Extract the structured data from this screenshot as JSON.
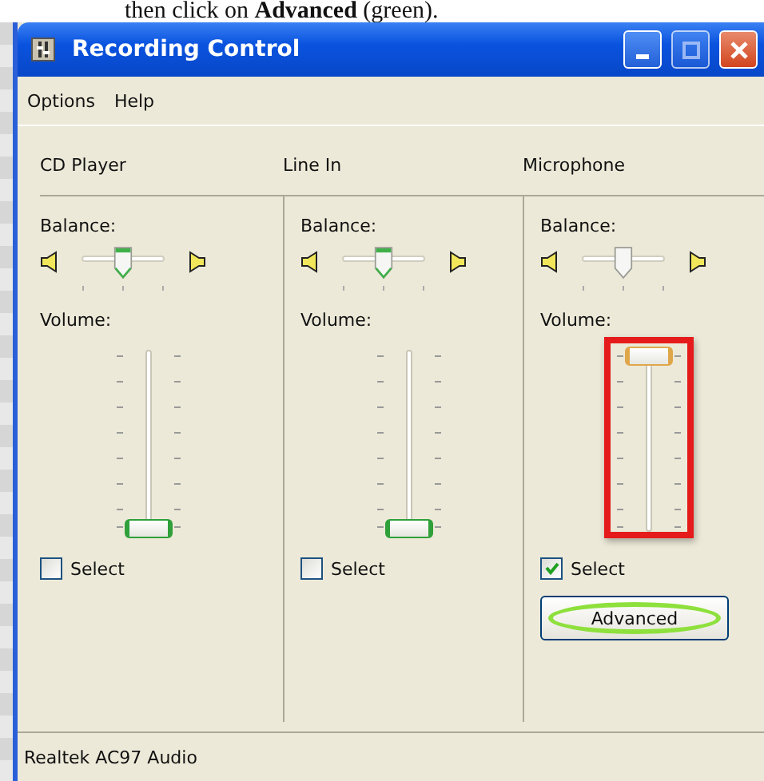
{
  "caption": "then click on **Advanced** (green).",
  "window": {
    "title": "Recording Control"
  },
  "menu": [
    {
      "label": "Options"
    },
    {
      "label": "Help"
    }
  ],
  "channels": [
    {
      "name": "CD Player",
      "balance_label": "Balance:",
      "balance": {
        "level": 0.5,
        "focused": false
      },
      "volume_label": "Volume:",
      "volume": {
        "level": 0.0,
        "focused": false,
        "highlighted": false
      },
      "select": {
        "label": "Select",
        "checked": false
      }
    },
    {
      "name": "Line In",
      "balance_label": "Balance:",
      "balance": {
        "level": 0.5,
        "focused": false
      },
      "volume_label": "Volume:",
      "volume": {
        "level": 0.0,
        "focused": false,
        "highlighted": false
      },
      "select": {
        "label": "Select",
        "checked": false
      }
    },
    {
      "name": "Microphone",
      "balance_label": "Balance:",
      "balance": {
        "level": 0.5,
        "focused": true
      },
      "volume_label": "Volume:",
      "volume": {
        "level": 1.0,
        "focused": true,
        "highlighted": true
      },
      "select": {
        "label": "Select",
        "checked": true
      },
      "advanced_button": {
        "label": "Advanced",
        "highlighted": true
      }
    }
  ],
  "status_bar": "Realtek AC97 Audio"
}
